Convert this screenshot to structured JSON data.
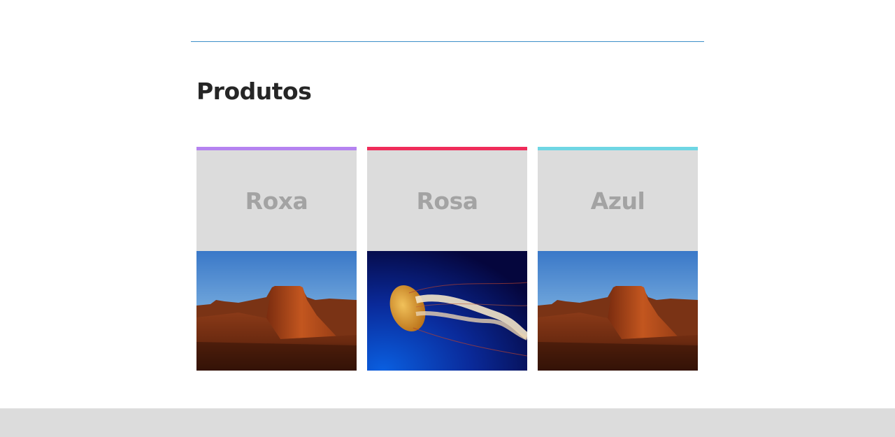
{
  "section": {
    "title": "Produtos"
  },
  "products": [
    {
      "label": "Roxa",
      "accent": "#b583f0",
      "image": "desert-mesa-photo"
    },
    {
      "label": "Rosa",
      "accent": "#ef2c5a",
      "image": "jellyfish-photo"
    },
    {
      "label": "Azul",
      "accent": "#6fd6e4",
      "image": "desert-mesa-photo"
    }
  ],
  "colors": {
    "divider": "#3d8fc9",
    "card_background": "#dcdcdc",
    "card_label": "#a3a3a3",
    "title": "#262626",
    "footer": "#dcdcdc"
  }
}
